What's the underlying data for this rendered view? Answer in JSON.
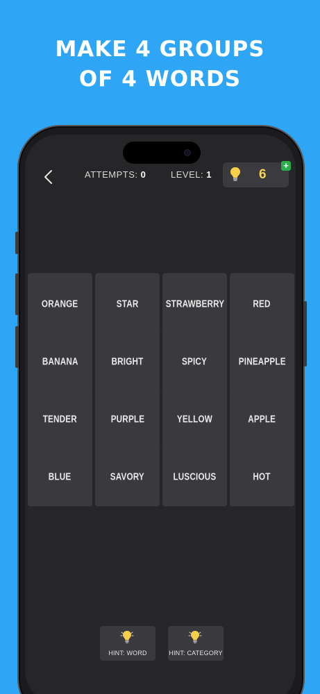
{
  "promo": {
    "line1": "MAKE 4 GROUPS",
    "line2": "OF 4 WORDS"
  },
  "header": {
    "back_icon": "chevron-left-icon",
    "attempts_label": "ATTEMPTS:",
    "attempts_value": "0",
    "level_label": "LEVEL:",
    "level_value": "1",
    "hints_count": "6",
    "hint_icon": "lightbulb-icon",
    "add_hints_icon": "plus-icon"
  },
  "board": {
    "tiles": [
      "ORANGE",
      "STAR",
      "STRAWBERRY",
      "RED",
      "BANANA",
      "BRIGHT",
      "SPICY",
      "PINEAPPLE",
      "TENDER",
      "PURPLE",
      "YELLOW",
      "APPLE",
      "BLUE",
      "SAVORY",
      "LUSCIOUS",
      "HOT"
    ]
  },
  "footer": {
    "hint_word_label": "HINT: WORD",
    "hint_category_label": "HINT: CATEGORY"
  },
  "colors": {
    "background": "#2fa6f5",
    "screen": "#262527",
    "tile": "#3a393d",
    "hint_count": "#f5d35c",
    "plus_badge": "#27b04a"
  }
}
